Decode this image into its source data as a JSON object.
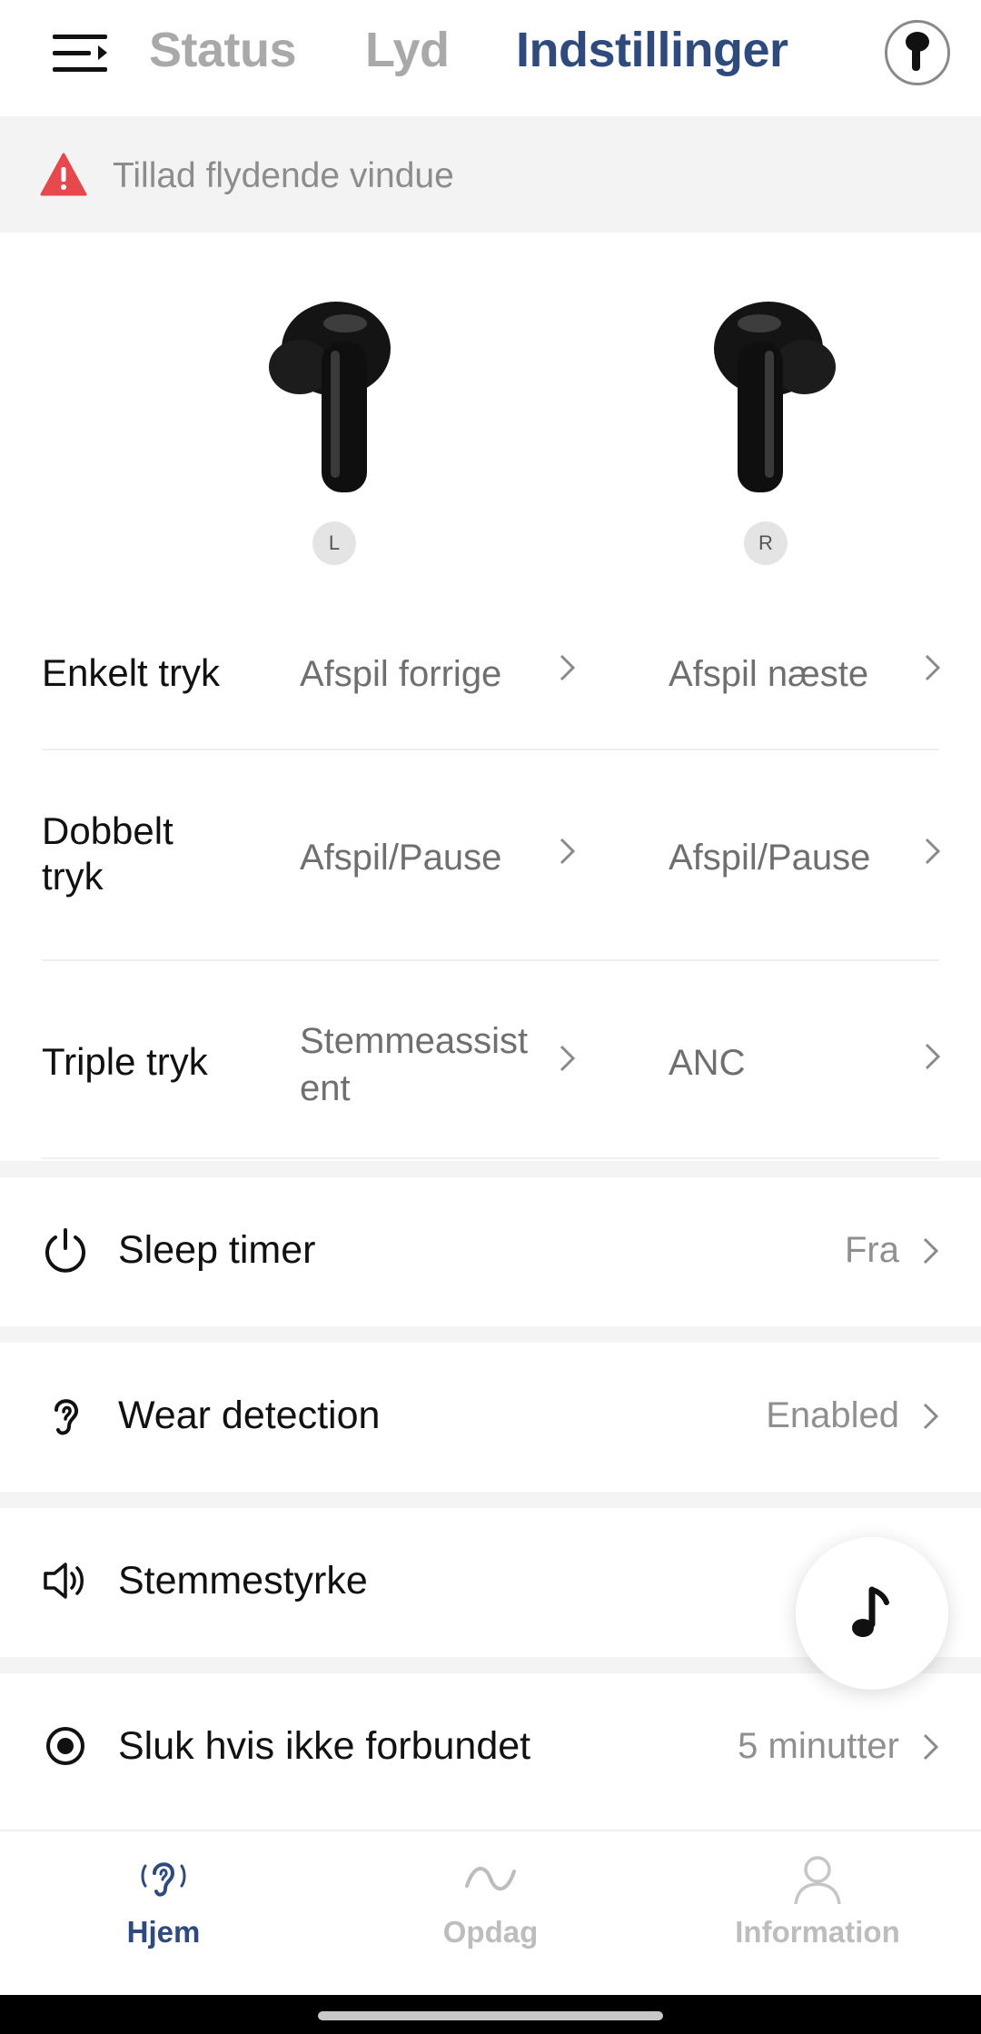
{
  "header": {
    "tabs": [
      {
        "label": "Status"
      },
      {
        "label": "Lyd"
      },
      {
        "label": "Indstillinger",
        "active": true
      }
    ],
    "menu_icon": "menu-icon",
    "device_icon": "earbud-icon",
    "active_color": "#2f4a7d",
    "inactive_color": "#a9a9a9"
  },
  "banner": {
    "icon": "warning-icon",
    "icon_color": "#e5484d",
    "text": "Tillad flydende vindue"
  },
  "earbuds": {
    "left_badge": "L",
    "right_badge": "R"
  },
  "gestures": [
    {
      "label": "Enkelt tryk",
      "left": "Afspil forrige",
      "right": "Afspil næste"
    },
    {
      "label": "Dobbelt tryk",
      "left": "Afspil/Pause",
      "right": "Afspil/Pause"
    },
    {
      "label": "Triple tryk",
      "left": "Stemmeassistent",
      "right": "ANC"
    }
  ],
  "settings": [
    {
      "icon": "power-icon",
      "label": "Sleep timer",
      "value": "Fra"
    },
    {
      "icon": "ear-icon",
      "label": "Wear detection",
      "value": "Enabled"
    },
    {
      "icon": "speaker-icon",
      "label": "Stemmestyrke",
      "value": ""
    },
    {
      "icon": "radio-dot-icon",
      "label": "Sluk hvis ikke forbundet",
      "value": "5 minutter"
    }
  ],
  "fab": {
    "icon": "music-note-icon"
  },
  "bottom_nav": [
    {
      "label": "Hjem",
      "icon": "hearing-icon",
      "active": true
    },
    {
      "label": "Opdag",
      "icon": "wave-icon",
      "active": false
    },
    {
      "label": "Information",
      "icon": "person-icon",
      "active": false
    }
  ]
}
